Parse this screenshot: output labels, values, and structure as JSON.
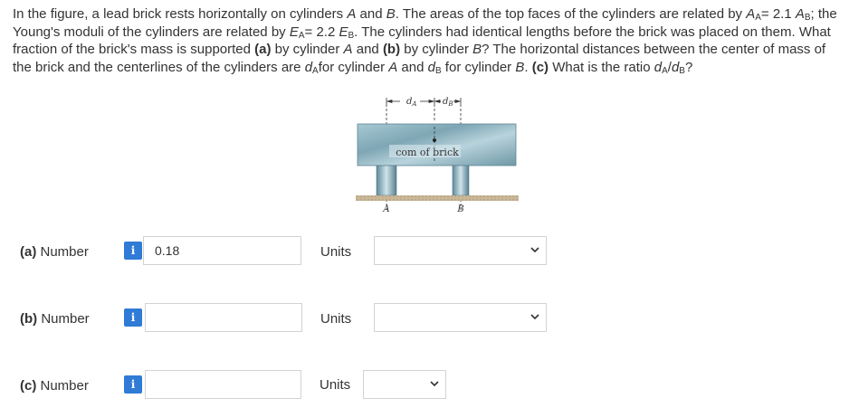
{
  "problem": {
    "t1": "In the figure, a lead brick rests horizontally on cylinders ",
    "A": "A",
    "t2": " and ",
    "B": "B",
    "t3": ". The areas of the top faces of the cylinders are related by ",
    "A_sym": "A",
    "sub_A": "A",
    "rel1": "= 2.1 ",
    "A_sym2": "A",
    "sub_B": "B",
    "t4": "; the Young's moduli of the cylinders are related by ",
    "E_sym": "E",
    "rel2": "= 2.2 ",
    "E_sym2": "E",
    "t5": ". The cylinders had identical lengths before the brick was placed on them. What fraction of the brick's mass is supported ",
    "pa": "(a)",
    "t6": " by cylinder ",
    "t7": " and ",
    "pb": "(b)",
    "t8": " by cylinder ",
    "t9": "? The horizontal distances between the center of mass of the brick and the centerlines of the cylinders are ",
    "d_sym": "d",
    "t10": "for cylinder ",
    "t11": " and ",
    "t12": " for cylinder ",
    "t13": ". ",
    "pc": "(c)",
    "t14": " What is the ratio ",
    "slash": "/",
    "t15": "?"
  },
  "figure": {
    "dA_label": "d",
    "dA_sub": "A",
    "dB_label": "d",
    "dB_sub": "B",
    "com_label": "com of brick",
    "cylA_label": "A",
    "cylB_label": "B"
  },
  "rows": [
    {
      "label_part": "(a)",
      "label_text": " Number",
      "info": "i",
      "value": "0.18",
      "units_label": "Units",
      "units_value": ""
    },
    {
      "label_part": "(b)",
      "label_text": " Number",
      "info": "i",
      "value": "",
      "units_label": "Units",
      "units_value": ""
    },
    {
      "label_part": "(c)",
      "label_text": " Number",
      "info": "i",
      "value": "",
      "units_label": "Units",
      "units_value": ""
    }
  ],
  "colors": {
    "info_badge": "#2f7bd6",
    "brick": "#8fb6c4",
    "chevron": "#333333"
  }
}
